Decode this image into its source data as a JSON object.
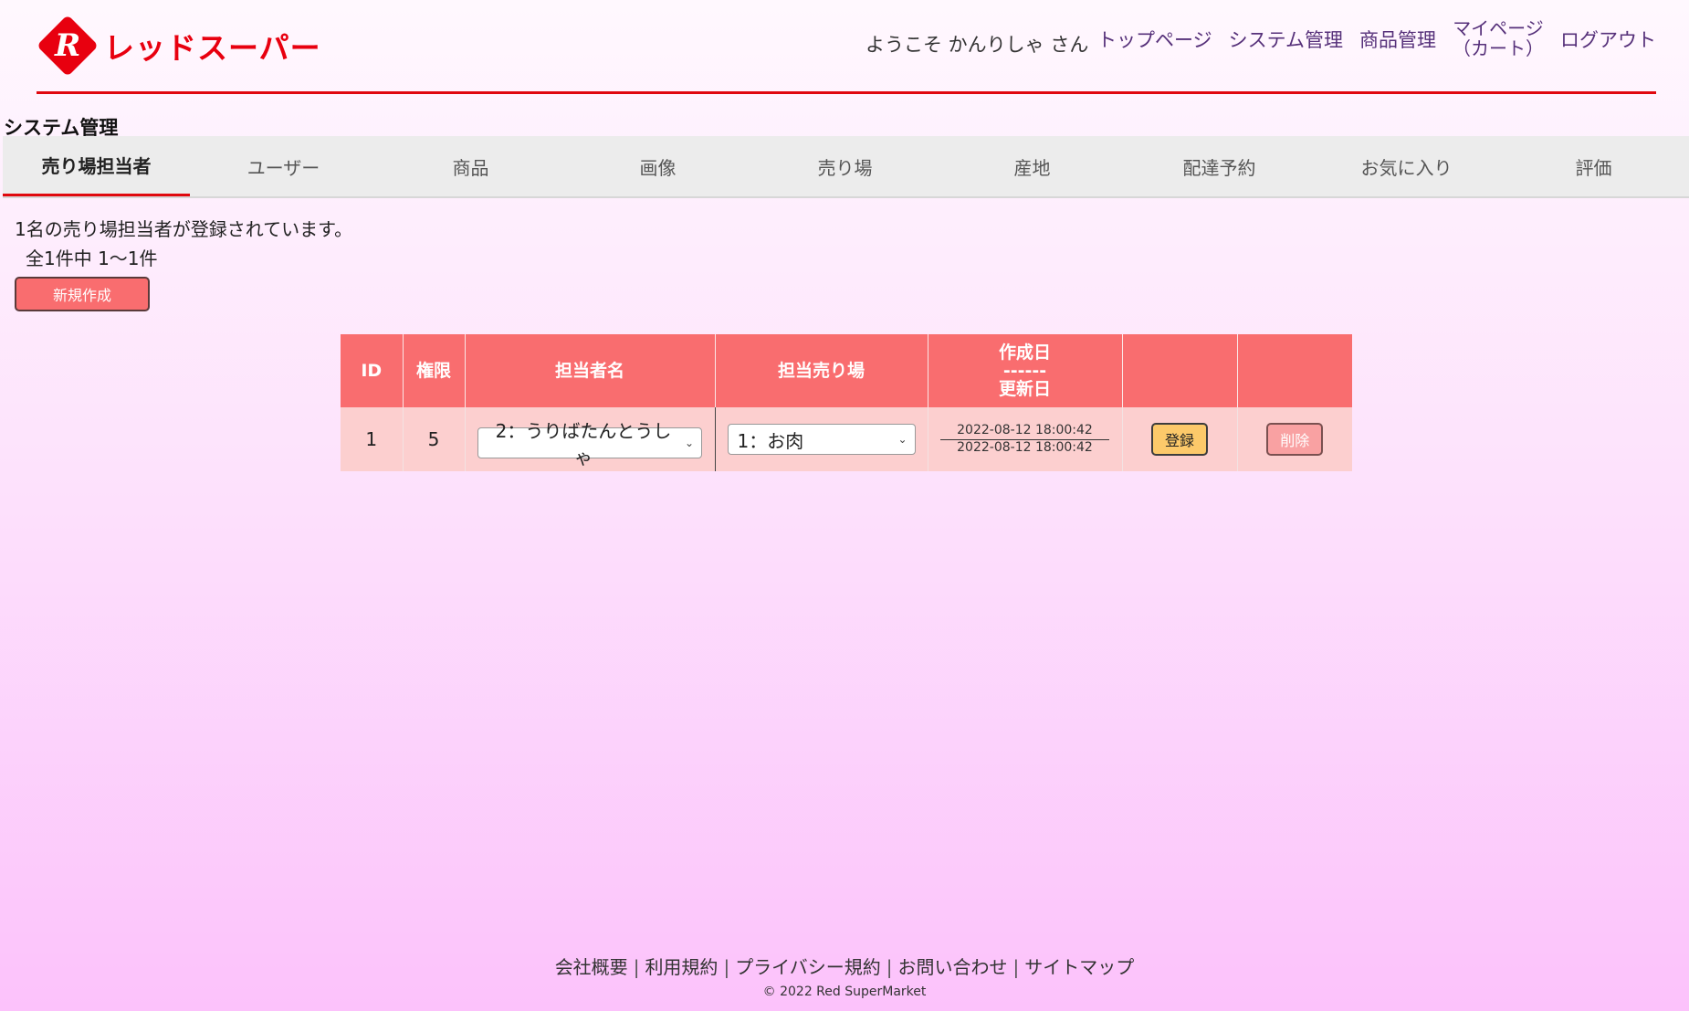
{
  "header": {
    "logo_mark": "R",
    "logo_text": "レッドスーパー",
    "welcome": "ようこそ かんりしゃ さん",
    "nav": [
      {
        "label": "トップページ"
      },
      {
        "label": "システム管理"
      },
      {
        "label": "商品管理"
      },
      {
        "label_line1": "マイページ",
        "label_line2": "（カート）"
      },
      {
        "label": "ログアウト"
      }
    ]
  },
  "page_title": "システム管理",
  "tabs": [
    {
      "label": "売り場担当者",
      "active": true
    },
    {
      "label": "ユーザー"
    },
    {
      "label": "商品"
    },
    {
      "label": "画像"
    },
    {
      "label": "売り場"
    },
    {
      "label": "産地"
    },
    {
      "label": "配達予約"
    },
    {
      "label": "お気に入り"
    },
    {
      "label": "評価"
    }
  ],
  "summary": {
    "count_text": "1名の売り場担当者が登録されています。",
    "range_text": "全1件中 1～1件"
  },
  "new_button": "新規作成",
  "table": {
    "headers": {
      "id": "ID",
      "auth": "権限",
      "name": "担当者名",
      "section": "担当売り場",
      "created": "作成日",
      "sep": "------",
      "updated": "更新日"
    },
    "rows": [
      {
        "id": "1",
        "auth": "5",
        "name": "2：うりばたんとうしゃ",
        "section": "1：お肉",
        "created": "2022-08-12 18:00:42",
        "updated": "2022-08-12 18:00:42",
        "register": "登録",
        "delete": "削除"
      }
    ]
  },
  "footer": {
    "links": [
      "会社概要",
      "利用規約",
      "プライバシー規約",
      "お問い合わせ",
      "サイトマップ"
    ],
    "separator": "|",
    "copyright": "© 2022 Red SuperMarket"
  },
  "colors": {
    "brand_red": "#e8000f",
    "header_table": "#f96d6f",
    "row_bg": "#fccfcf",
    "register_btn": "#fcc96a",
    "nav_link": "#56307a"
  }
}
